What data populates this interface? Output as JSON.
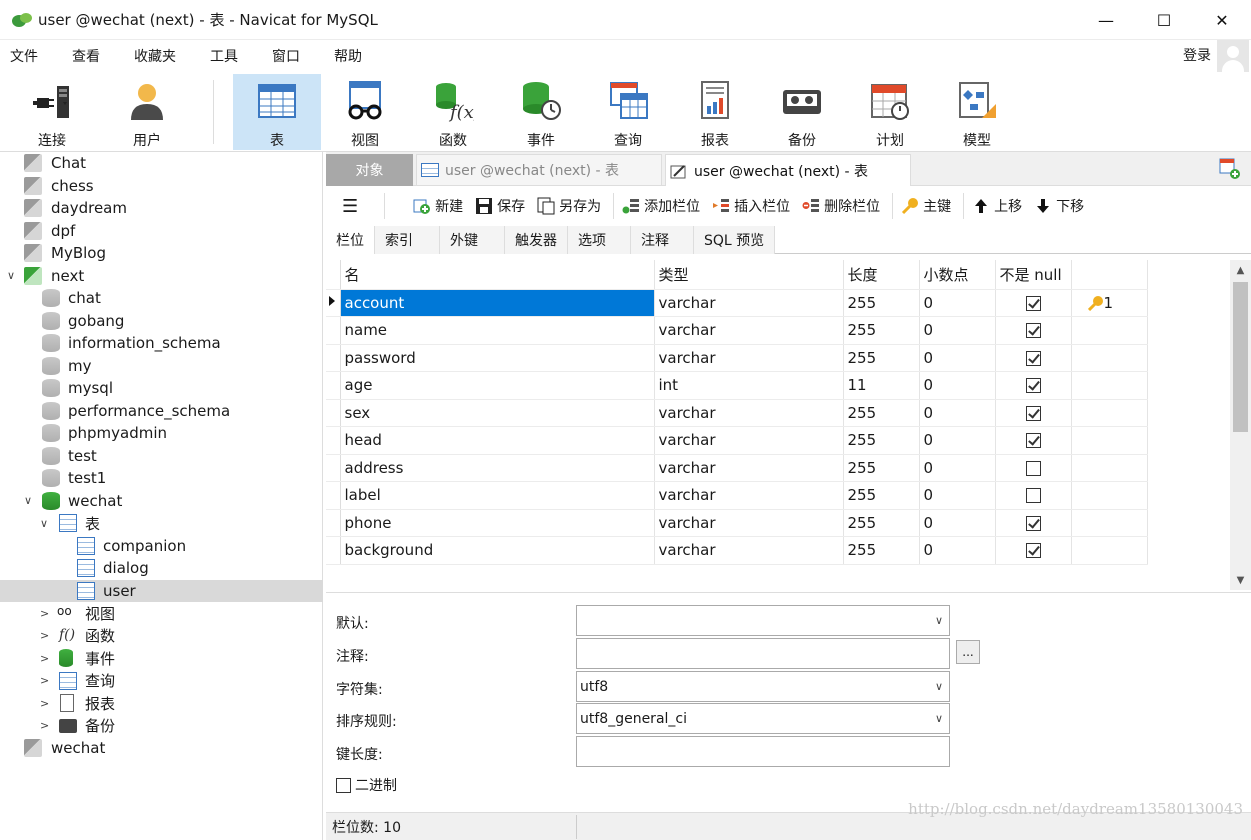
{
  "window": {
    "title": "user @wechat (next) - 表 - Navicat for MySQL",
    "minimize": "—",
    "maximize": "☐",
    "close": "✕"
  },
  "menu": [
    "文件",
    "查看",
    "收藏夹",
    "工具",
    "窗口",
    "帮助"
  ],
  "login": "登录",
  "toolbar": [
    {
      "label": "连接",
      "icon": "plug-icon"
    },
    {
      "label": "用户",
      "icon": "user-icon"
    },
    {
      "label": "表",
      "icon": "table-icon",
      "active": true
    },
    {
      "label": "视图",
      "icon": "glasses-icon"
    },
    {
      "label": "函数",
      "icon": "function-icon"
    },
    {
      "label": "事件",
      "icon": "event-icon"
    },
    {
      "label": "查询",
      "icon": "query-icon"
    },
    {
      "label": "报表",
      "icon": "report-icon"
    },
    {
      "label": "备份",
      "icon": "backup-icon"
    },
    {
      "label": "计划",
      "icon": "calendar-icon"
    },
    {
      "label": "模型",
      "icon": "model-icon"
    }
  ],
  "tree": [
    {
      "label": "Chat",
      "kind": "conn"
    },
    {
      "label": "chess",
      "kind": "conn"
    },
    {
      "label": "daydream",
      "kind": "conn"
    },
    {
      "label": "dpf",
      "kind": "conn"
    },
    {
      "label": "MyBlog",
      "kind": "conn"
    },
    {
      "label": "next",
      "kind": "conn-open"
    },
    {
      "label": "chat",
      "kind": "db"
    },
    {
      "label": "gobang",
      "kind": "db"
    },
    {
      "label": "information_schema",
      "kind": "db"
    },
    {
      "label": "my",
      "kind": "db"
    },
    {
      "label": "mysql",
      "kind": "db"
    },
    {
      "label": "performance_schema",
      "kind": "db"
    },
    {
      "label": "phpmyadmin",
      "kind": "db"
    },
    {
      "label": "test",
      "kind": "db"
    },
    {
      "label": "test1",
      "kind": "db"
    },
    {
      "label": "wechat",
      "kind": "db-open"
    },
    {
      "label": "表",
      "kind": "folder-tables"
    },
    {
      "label": "companion",
      "kind": "table"
    },
    {
      "label": "dialog",
      "kind": "table"
    },
    {
      "label": "user",
      "kind": "table",
      "selected": true
    },
    {
      "label": "视图",
      "kind": "folder-views"
    },
    {
      "label": "函数",
      "kind": "folder-functions"
    },
    {
      "label": "事件",
      "kind": "folder-events"
    },
    {
      "label": "查询",
      "kind": "folder-queries"
    },
    {
      "label": "报表",
      "kind": "folder-reports"
    },
    {
      "label": "备份",
      "kind": "folder-backups"
    },
    {
      "label": "wechat",
      "kind": "conn"
    }
  ],
  "tabs": {
    "objects": "对象",
    "tab1": "user @wechat (next) - 表",
    "tab2": "user @wechat (next) - 表"
  },
  "editor_toolbar": {
    "menu": "☰",
    "new": "新建",
    "save": "保存",
    "save_as": "另存为",
    "add_field": "添加栏位",
    "insert_field": "插入栏位",
    "delete_field": "删除栏位",
    "primary_key": "主键",
    "move_up": "上移",
    "move_down": "下移"
  },
  "subtabs": [
    "栏位",
    "索引",
    "外键",
    "触发器",
    "选项",
    "注释",
    "SQL 预览"
  ],
  "grid": {
    "headers": {
      "name": "名",
      "type": "类型",
      "length": "长度",
      "decimals": "小数点",
      "not_null": "不是 null",
      "key": ""
    },
    "rows": [
      {
        "name": "account",
        "type": "varchar",
        "length": "255",
        "decimals": "0",
        "not_null": true,
        "key": "1"
      },
      {
        "name": "name",
        "type": "varchar",
        "length": "255",
        "decimals": "0",
        "not_null": true,
        "key": ""
      },
      {
        "name": "password",
        "type": "varchar",
        "length": "255",
        "decimals": "0",
        "not_null": true,
        "key": ""
      },
      {
        "name": "age",
        "type": "int",
        "length": "11",
        "decimals": "0",
        "not_null": true,
        "key": ""
      },
      {
        "name": "sex",
        "type": "varchar",
        "length": "255",
        "decimals": "0",
        "not_null": true,
        "key": ""
      },
      {
        "name": "head",
        "type": "varchar",
        "length": "255",
        "decimals": "0",
        "not_null": true,
        "key": ""
      },
      {
        "name": "address",
        "type": "varchar",
        "length": "255",
        "decimals": "0",
        "not_null": false,
        "key": ""
      },
      {
        "name": "label",
        "type": "varchar",
        "length": "255",
        "decimals": "0",
        "not_null": false,
        "key": ""
      },
      {
        "name": "phone",
        "type": "varchar",
        "length": "255",
        "decimals": "0",
        "not_null": true,
        "key": ""
      },
      {
        "name": "background",
        "type": "varchar",
        "length": "255",
        "decimals": "0",
        "not_null": true,
        "key": ""
      }
    ]
  },
  "props": {
    "default_label": "默认:",
    "default_value": "",
    "comment_label": "注释:",
    "comment_value": "",
    "charset_label": "字符集:",
    "charset_value": "utf8",
    "collation_label": "排序规则:",
    "collation_value": "utf8_general_ci",
    "keylen_label": "键长度:",
    "keylen_value": "",
    "binary_label": "二进制",
    "ellipsis": "..."
  },
  "status": {
    "field_count": "栏位数: 10"
  },
  "watermark": "http://blog.csdn.net/daydream13580130043"
}
